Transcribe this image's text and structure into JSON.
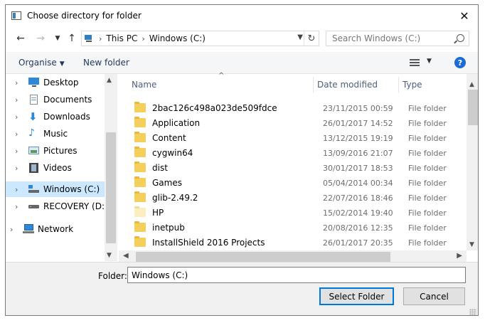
{
  "window": {
    "title": "Choose directory for folder"
  },
  "nav": {
    "back": "back-arrow",
    "forward": "forward-arrow",
    "recent": "chevron-down",
    "up": "up-arrow"
  },
  "address": {
    "crumbs": [
      "This PC",
      "Windows (C:)"
    ]
  },
  "search": {
    "placeholder": "Search Windows (C:)"
  },
  "toolbar": {
    "organise_label": "Organise",
    "new_folder_label": "New folder",
    "help_label": "?"
  },
  "sidebar": {
    "items": [
      {
        "label": "Desktop",
        "icon": "desktop-icon"
      },
      {
        "label": "Documents",
        "icon": "documents-icon"
      },
      {
        "label": "Downloads",
        "icon": "downloads-icon"
      },
      {
        "label": "Music",
        "icon": "music-icon"
      },
      {
        "label": "Pictures",
        "icon": "pictures-icon"
      },
      {
        "label": "Videos",
        "icon": "videos-icon"
      },
      {
        "label": "Windows (C:)",
        "icon": "drive-c-icon",
        "selected": true
      },
      {
        "label": "RECOVERY (D:)",
        "icon": "drive-d-icon"
      },
      {
        "label": "Network",
        "icon": "network-icon"
      }
    ]
  },
  "filelist": {
    "columns": {
      "name": "Name",
      "date": "Date modified",
      "type": "Type"
    },
    "rows": [
      {
        "name": "2bac126c498a023de509fdce",
        "date": "23/11/2015 00:59",
        "type": "File folder"
      },
      {
        "name": "Application",
        "date": "26/01/2017 14:52",
        "type": "File folder"
      },
      {
        "name": "Content",
        "date": "13/12/2015 19:19",
        "type": "File folder"
      },
      {
        "name": "cygwin64",
        "date": "13/09/2016 21:07",
        "type": "File folder"
      },
      {
        "name": "dist",
        "date": "30/01/2017 18:53",
        "type": "File folder"
      },
      {
        "name": "Games",
        "date": "05/04/2014 00:34",
        "type": "File folder"
      },
      {
        "name": "glib-2.49.2",
        "date": "22/07/2016 18:46",
        "type": "File folder"
      },
      {
        "name": "HP",
        "date": "15/02/2014 19:40",
        "type": "File folder",
        "hidden": true
      },
      {
        "name": "inetpub",
        "date": "20/08/2016 12:35",
        "type": "File folder"
      },
      {
        "name": "InstallShield 2016 Projects",
        "date": "26/01/2017 20:35",
        "type": "File folder"
      }
    ]
  },
  "footer": {
    "folder_label": "Folder:",
    "folder_value": "Windows (C:)",
    "select_label": "Select Folder",
    "cancel_label": "Cancel"
  },
  "colors": {
    "accent": "#0078d7",
    "selection": "#cce8ff",
    "folder": "#f4cf5a",
    "help": "#1c6bd2"
  }
}
